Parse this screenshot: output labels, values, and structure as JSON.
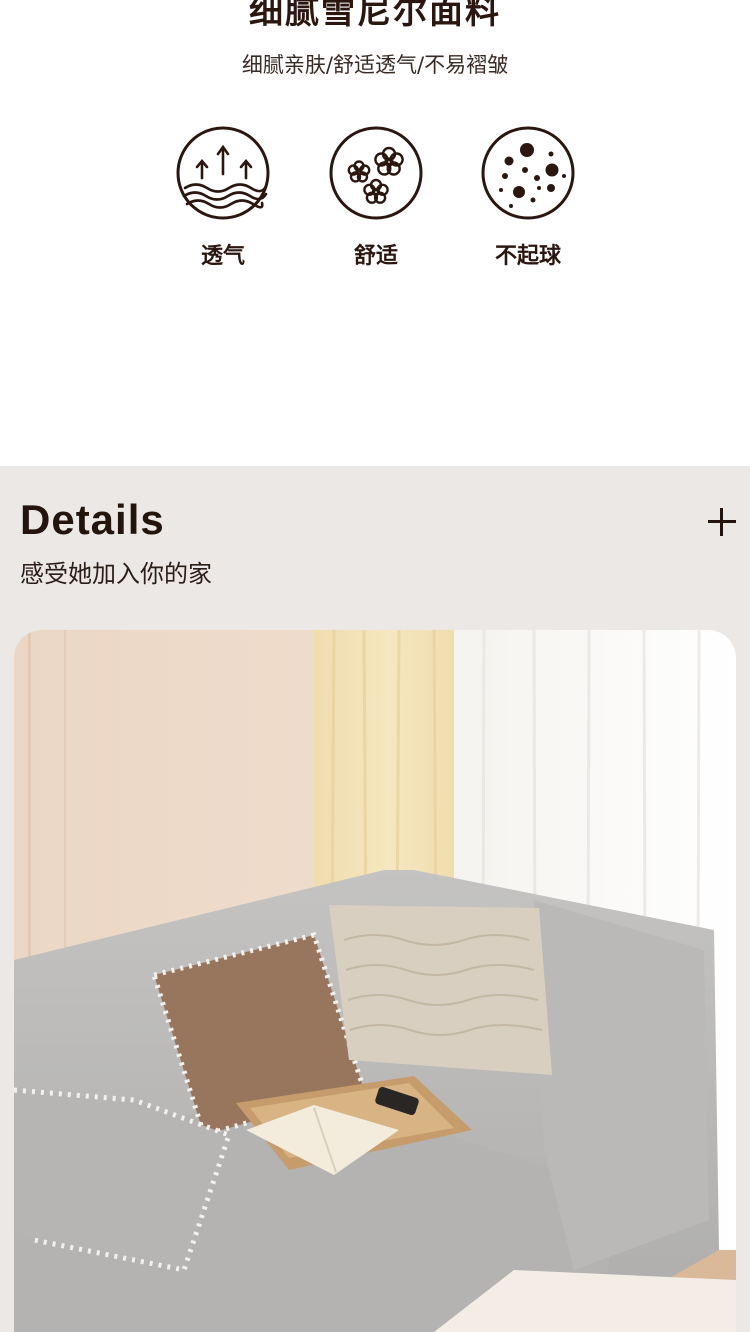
{
  "header": {
    "title": "细腻雪尼尔面料",
    "subtitle": "细腻亲肤/舒适透气/不易褶皱"
  },
  "features": [
    {
      "icon": "breathable-icon",
      "label": "透气"
    },
    {
      "icon": "flowers-icon",
      "label": "舒适"
    },
    {
      "icon": "dots-icon",
      "label": "不起球"
    }
  ],
  "details": {
    "heading": "Details",
    "subheading": "感受她加入你的家"
  },
  "colors": {
    "text_dark": "#2b1710",
    "section_bg": "#ebe8e5",
    "sofa_gray": "#b9b8b6"
  }
}
